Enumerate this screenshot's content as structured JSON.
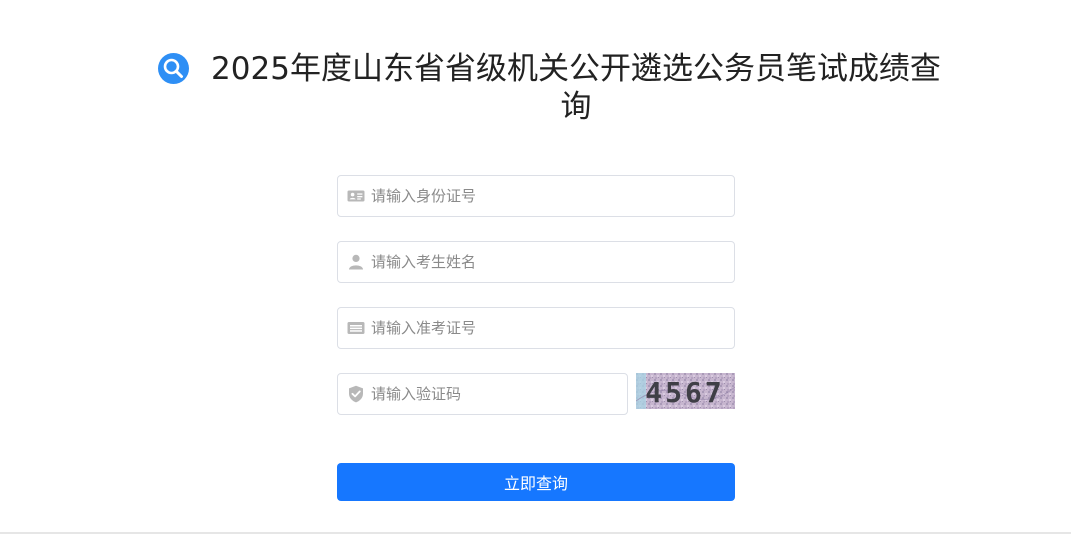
{
  "header": {
    "title": "2025年度山东省省级机关公开遴选公务员笔试成绩查询",
    "icon": "search-icon",
    "icon_color": "#2e8ff5"
  },
  "form": {
    "id_card": {
      "placeholder": "请输入身份证号",
      "icon": "id-card-icon"
    },
    "name": {
      "placeholder": "请输入考生姓名",
      "icon": "user-icon"
    },
    "ticket": {
      "placeholder": "请输入准考证号",
      "icon": "ticket-icon"
    },
    "captcha": {
      "placeholder": "请输入验证码",
      "icon": "shield-check-icon",
      "image_text": "4567"
    },
    "submit_label": "立即查询",
    "accent_color": "#1677ff"
  }
}
